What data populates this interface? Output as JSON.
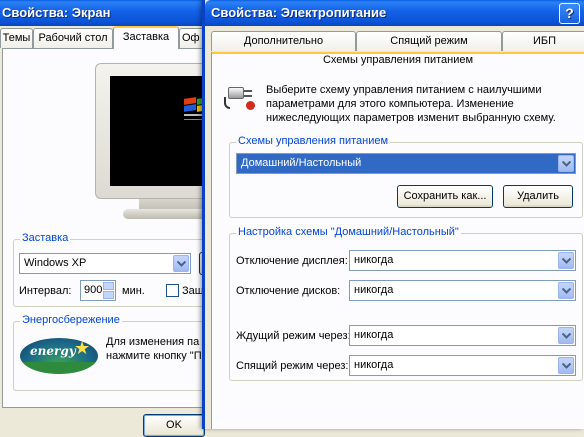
{
  "back_window": {
    "title": "Свойства: Экран",
    "tabs": [
      "Темы",
      "Рабочий стол",
      "Заставка",
      "Оф"
    ],
    "active_tab": "Заставка",
    "screensaver_group": {
      "title": "Заставка",
      "selected": "Windows XP",
      "interval_label": "Интервал:",
      "interval_value": "900",
      "interval_unit": "мин.",
      "checkbox_label": "Защ"
    },
    "energy_group": {
      "title": "Энергосбережение",
      "text_line1": "Для изменения па",
      "text_line2": "нажмите кнопку \"П"
    },
    "ok_label": "OK"
  },
  "window": {
    "title": "Свойства: Электропитание",
    "help_label": "?",
    "tabs": [
      "Дополнительно",
      "Спящий режим",
      "ИБП"
    ],
    "active_tab": "Схемы управления питанием",
    "description": [
      "Выберите схему управления питанием с наилучшими",
      "параметрами для этого компьютера. Изменение",
      "нижеследующих параметров изменит выбранную схему."
    ],
    "schemes_group": {
      "title": "Схемы управления питанием",
      "selected": "Домашний/Настольный",
      "save_as_label": "Сохранить как...",
      "delete_label": "Удалить"
    },
    "settings_group": {
      "title": "Настройка схемы \"Домашний/Настольный\"",
      "rows": [
        {
          "label": "Отключение дисплея:",
          "value": "никогда"
        },
        {
          "label": "Отключение дисков:",
          "value": "никогда"
        },
        {
          "label": "Ждущий режим через:",
          "value": "никогда"
        },
        {
          "label": "Спящий режим через:",
          "value": "никогда"
        }
      ]
    }
  },
  "colors": {
    "title_bar": "#0b52d6",
    "selection": "#316ac5",
    "group_title": "#0046d5",
    "active_tab_accent": "#ffc83c"
  }
}
